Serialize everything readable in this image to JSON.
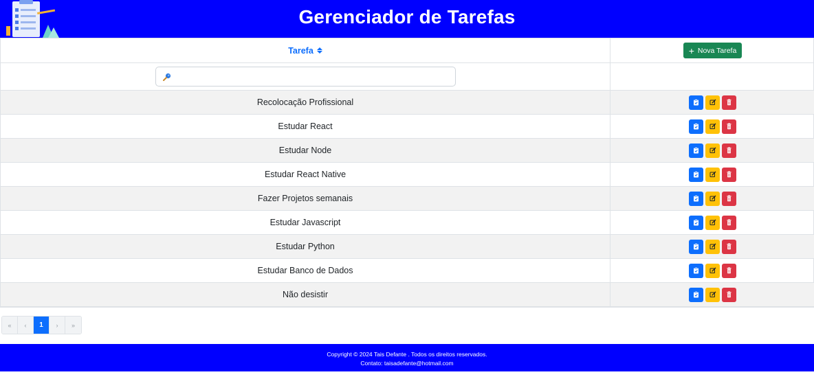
{
  "header": {
    "title": "Gerenciador de Tarefas",
    "logo_icon": "task-clipboard-logo"
  },
  "table": {
    "column_task_label": "Tarefa",
    "new_task_label": "Nova Tarefa",
    "search": {
      "value": "",
      "placeholder": ""
    },
    "rows": [
      {
        "task": "Recolocação Profissional"
      },
      {
        "task": "Estudar React"
      },
      {
        "task": "Estudar Node"
      },
      {
        "task": "Estudar React Native"
      },
      {
        "task": "Fazer Projetos semanais"
      },
      {
        "task": "Estudar Javascript"
      },
      {
        "task": "Estudar Python"
      },
      {
        "task": "Estudar Banco de Dados"
      },
      {
        "task": "Não desistir"
      }
    ]
  },
  "pagination": {
    "first": "«",
    "prev": "‹",
    "current": "1",
    "next": "›",
    "last": "»"
  },
  "footer": {
    "copyright": "Copyright © 2024 Tais Defante . Todos os direitos reservados.",
    "contact": "Contato: taisadefante@hotmail.com"
  },
  "colors": {
    "brand": "#0000ff",
    "success": "#198754",
    "primary": "#0d6efd",
    "warning": "#ffc107",
    "danger": "#dc3545"
  }
}
